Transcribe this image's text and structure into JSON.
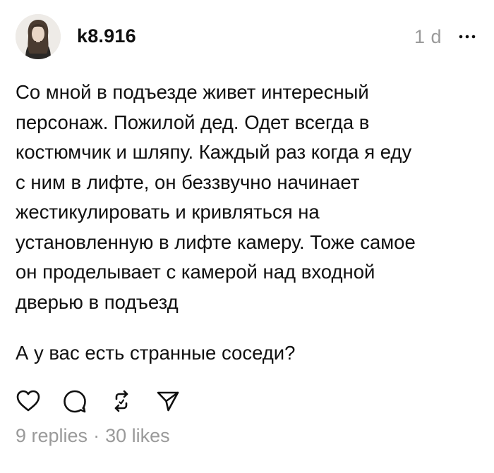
{
  "post": {
    "username": "k8.916",
    "timestamp": "1 d",
    "body": "Со мной в подъезде живет интересный\nперсонаж. Пожилой дед. Одет всегда в\nкостюмчик и шляпу. Каждый раз когда я еду\nс ним в лифте, он беззвучно начинает\nжестикулировать и кривляться на\nустановленную в лифте камеру. Тоже самое\nон проделывает с камерой над входной\nдверью в подъезд",
    "question": "А у вас есть странные соседи?",
    "replies": "9 replies",
    "separator": "·",
    "likes": "30 likes"
  },
  "icons": {
    "more": "more-horizontal-icon",
    "like": "heart-icon",
    "reply": "comment-icon",
    "repost": "repost-icon",
    "share": "send-icon"
  },
  "colors": {
    "text": "#101010",
    "muted": "#9a9a9a",
    "background": "#ffffff"
  }
}
